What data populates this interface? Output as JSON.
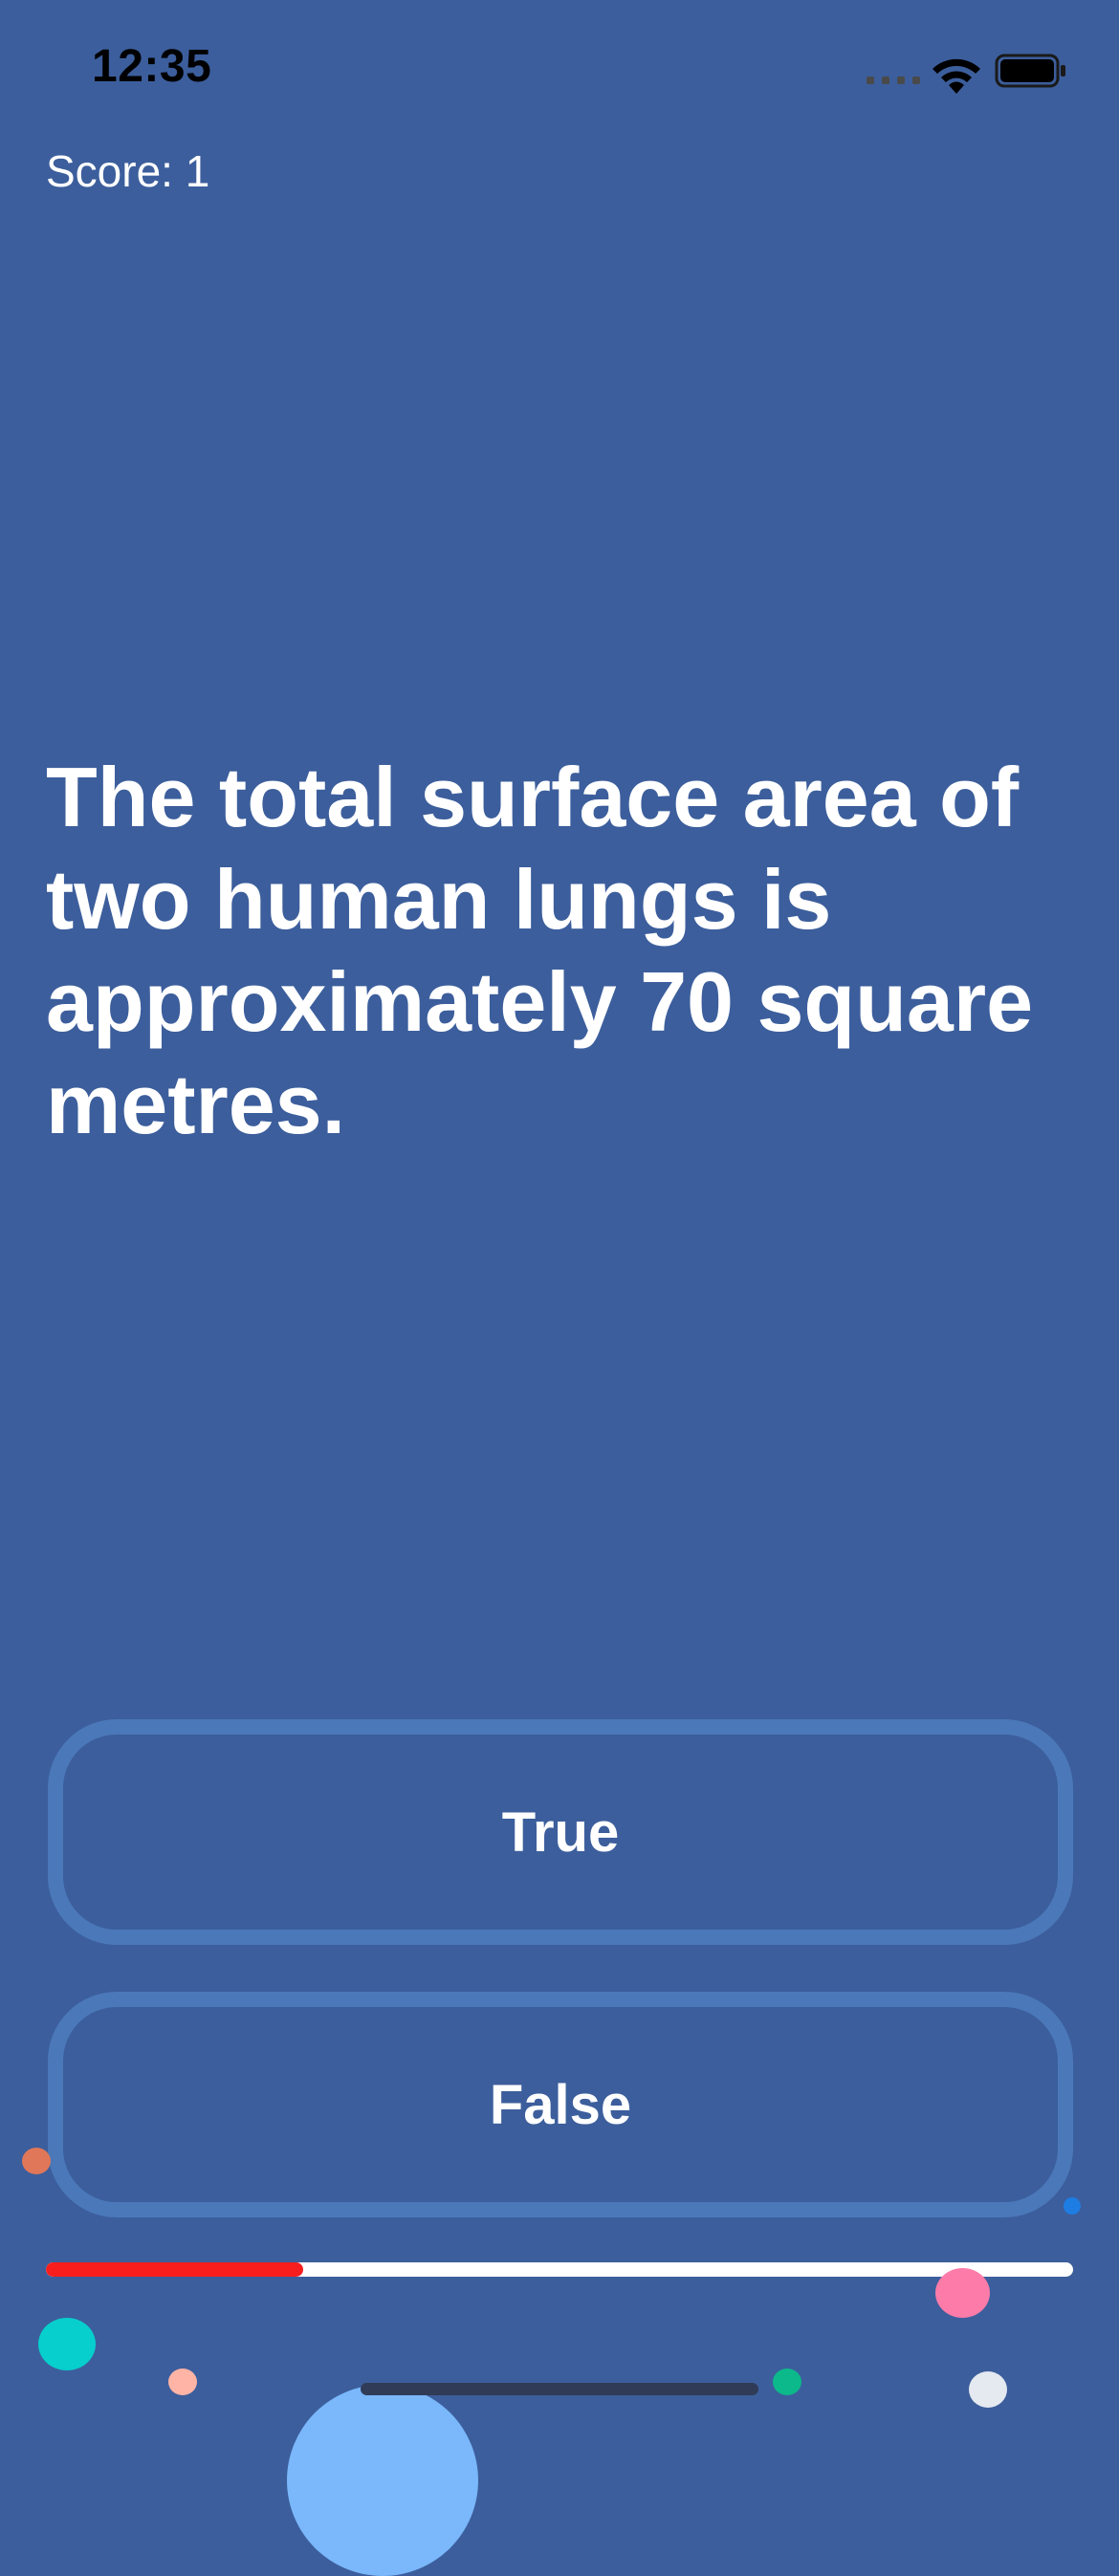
{
  "status_bar": {
    "time": "12:35",
    "signal_icon": "cellular-signal-icon",
    "wifi_icon": "wifi-icon",
    "battery_icon": "battery-icon"
  },
  "score": {
    "label": "Score: 1",
    "value": 1
  },
  "question": {
    "text": "The total surface area of two human lungs is approximately 70 square metres."
  },
  "answers": {
    "true_label": "True",
    "false_label": "False"
  },
  "progress": {
    "fraction": 0.25,
    "fill_color": "#f81e1e",
    "track_color": "#ffffff"
  },
  "colors": {
    "background": "#3c5e9c",
    "button_border": "#4b78b9"
  }
}
